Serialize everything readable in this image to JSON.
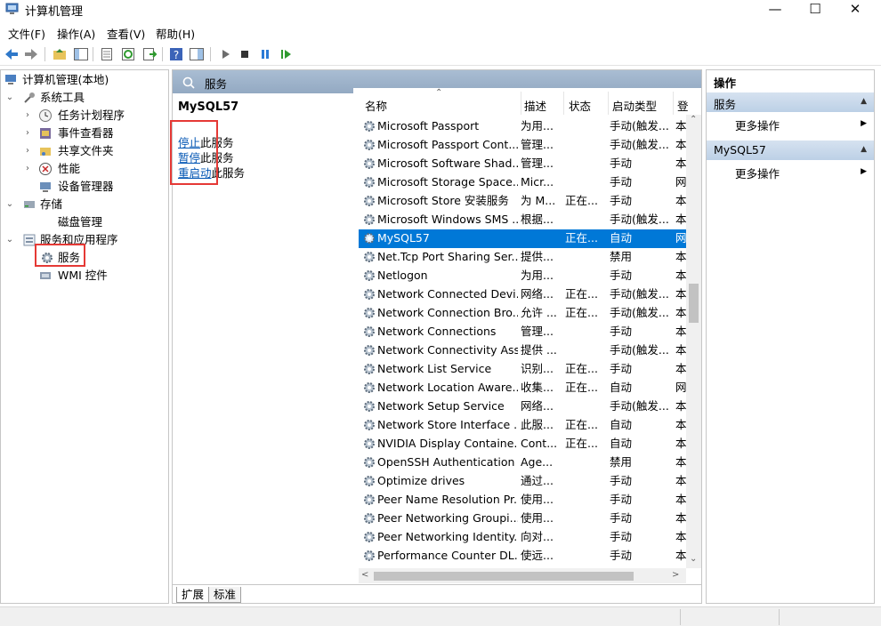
{
  "window": {
    "title": "计算机管理"
  },
  "menu": [
    "文件(F)",
    "操作(A)",
    "查看(V)",
    "帮助(H)"
  ],
  "toolbar": [
    "back-icon",
    "forward-icon",
    "up-folder-icon",
    "show-tree-icon",
    "properties-icon",
    "refresh-icon",
    "export-icon",
    "help-icon",
    "console-icon",
    "play-icon",
    "stop-icon",
    "pause-icon",
    "resume-icon"
  ],
  "tree": {
    "root": "计算机管理(本地)",
    "system_tools": "系统工具",
    "task_scheduler": "任务计划程序",
    "event_viewer": "事件查看器",
    "shared_folders": "共享文件夹",
    "performance": "性能",
    "device_manager": "设备管理器",
    "storage": "存储",
    "disk_management": "磁盘管理",
    "services_apps": "服务和应用程序",
    "services": "服务",
    "wmi": "WMI 控件"
  },
  "middle": {
    "header": "服务",
    "selected_service": "MySQL57",
    "actions": [
      {
        "link": "停止",
        "rest": "此服务"
      },
      {
        "link": "暂停",
        "rest": "此服务"
      },
      {
        "link": "重启动",
        "rest": "此服务"
      }
    ],
    "columns": {
      "name": "名称",
      "desc": "描述",
      "status": "状态",
      "startup": "启动类型",
      "logon": "登"
    },
    "rows": [
      {
        "name": "Microsoft Passport",
        "desc": "为用...",
        "status": "",
        "startup": "手动(触发...",
        "logon": "本"
      },
      {
        "name": "Microsoft Passport Cont...",
        "desc": "管理...",
        "status": "",
        "startup": "手动(触发...",
        "logon": "本"
      },
      {
        "name": "Microsoft Software Shad...",
        "desc": "管理...",
        "status": "",
        "startup": "手动",
        "logon": "本"
      },
      {
        "name": "Microsoft Storage Space...",
        "desc": "Micr...",
        "status": "",
        "startup": "手动",
        "logon": "网"
      },
      {
        "name": "Microsoft Store 安装服务",
        "desc": "为 M...",
        "status": "正在...",
        "startup": "手动",
        "logon": "本"
      },
      {
        "name": "Microsoft Windows SMS ...",
        "desc": "根据...",
        "status": "",
        "startup": "手动(触发...",
        "logon": "本"
      },
      {
        "name": "MySQL57",
        "desc": "",
        "status": "正在...",
        "startup": "自动",
        "logon": "网"
      },
      {
        "name": "Net.Tcp Port Sharing Ser...",
        "desc": "提供...",
        "status": "",
        "startup": "禁用",
        "logon": "本"
      },
      {
        "name": "Netlogon",
        "desc": "为用...",
        "status": "",
        "startup": "手动",
        "logon": "本"
      },
      {
        "name": "Network Connected Devi...",
        "desc": "网络...",
        "status": "正在...",
        "startup": "手动(触发...",
        "logon": "本"
      },
      {
        "name": "Network Connection Bro...",
        "desc": "允许 ...",
        "status": "正在...",
        "startup": "手动(触发...",
        "logon": "本"
      },
      {
        "name": "Network Connections",
        "desc": "管理...",
        "status": "",
        "startup": "手动",
        "logon": "本"
      },
      {
        "name": "Network Connectivity Ass...",
        "desc": "提供 ...",
        "status": "",
        "startup": "手动(触发...",
        "logon": "本"
      },
      {
        "name": "Network List Service",
        "desc": "识别...",
        "status": "正在...",
        "startup": "手动",
        "logon": "本"
      },
      {
        "name": "Network Location Aware...",
        "desc": "收集...",
        "status": "正在...",
        "startup": "自动",
        "logon": "网"
      },
      {
        "name": "Network Setup Service",
        "desc": "网络...",
        "status": "",
        "startup": "手动(触发...",
        "logon": "本"
      },
      {
        "name": "Network Store Interface ...",
        "desc": "此服...",
        "status": "正在...",
        "startup": "自动",
        "logon": "本"
      },
      {
        "name": "NVIDIA Display Containe...",
        "desc": "Cont...",
        "status": "正在...",
        "startup": "自动",
        "logon": "本"
      },
      {
        "name": "OpenSSH Authentication ...",
        "desc": "Age...",
        "status": "",
        "startup": "禁用",
        "logon": "本"
      },
      {
        "name": "Optimize drives",
        "desc": "通过...",
        "status": "",
        "startup": "手动",
        "logon": "本"
      },
      {
        "name": "Peer Name Resolution Pr...",
        "desc": "使用...",
        "status": "",
        "startup": "手动",
        "logon": "本"
      },
      {
        "name": "Peer Networking Groupi...",
        "desc": "使用...",
        "status": "",
        "startup": "手动",
        "logon": "本"
      },
      {
        "name": "Peer Networking Identity...",
        "desc": "向对...",
        "status": "",
        "startup": "手动",
        "logon": "本"
      },
      {
        "name": "Performance Counter DL...",
        "desc": "使远...",
        "status": "",
        "startup": "手动",
        "logon": "本"
      }
    ],
    "tabs": [
      "扩展",
      "标准"
    ]
  },
  "actions_panel": {
    "title": "操作",
    "section1": "服务",
    "section1_item": "更多操作",
    "section2": "MySQL57",
    "section2_item": "更多操作"
  },
  "colors": {
    "selection": "#0078d7",
    "highlight": "#e53935",
    "link": "#0054b3"
  }
}
